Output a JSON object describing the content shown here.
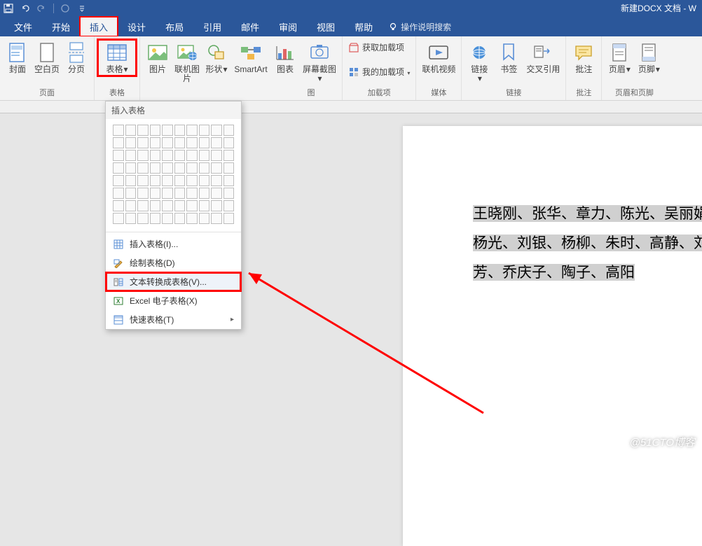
{
  "titlebar": {
    "doc_title": "新建DOCX 文档  -  W"
  },
  "menubar": {
    "items": [
      "文件",
      "开始",
      "插入",
      "设计",
      "布局",
      "引用",
      "邮件",
      "审阅",
      "视图",
      "帮助"
    ],
    "tell_me": "操作说明搜索"
  },
  "ribbon": {
    "pages_group": "页面",
    "cover_page": "封面",
    "blank_page": "空白页",
    "page_break": "分页",
    "tables_group": "表格",
    "table": "表格",
    "illustrations_group": "图",
    "pictures": "图片",
    "online_pictures": "联机图片",
    "shapes": "形状",
    "smartart": "SmartArt",
    "chart": "图表",
    "screenshot": "屏幕截图",
    "addins_group": "加载项",
    "get_addins": "获取加载项",
    "my_addins": "我的加载项",
    "media_group": "媒体",
    "online_video": "联机视频",
    "links_group": "链接",
    "link": "链接",
    "bookmark": "书签",
    "cross_ref": "交叉引用",
    "comments_group": "批注",
    "comment": "批注",
    "headerfooter_group": "页眉和页脚",
    "header": "页眉",
    "footer": "页脚"
  },
  "table_menu": {
    "title": "插入表格",
    "insert_table": "插入表格(I)...",
    "draw_table": "绘制表格(D)",
    "text_to_table": "文本转换成表格(V)...",
    "excel": "Excel 电子表格(X)",
    "quick_tables": "快速表格(T)"
  },
  "document": {
    "line1": "王晓刚、张华、章力、陈光、吴丽娟",
    "line2": "杨光、刘银、杨柳、朱时、高静、刘",
    "line3": "芳、乔庆子、陶子、高阳"
  },
  "watermark": "@51CTO博客"
}
